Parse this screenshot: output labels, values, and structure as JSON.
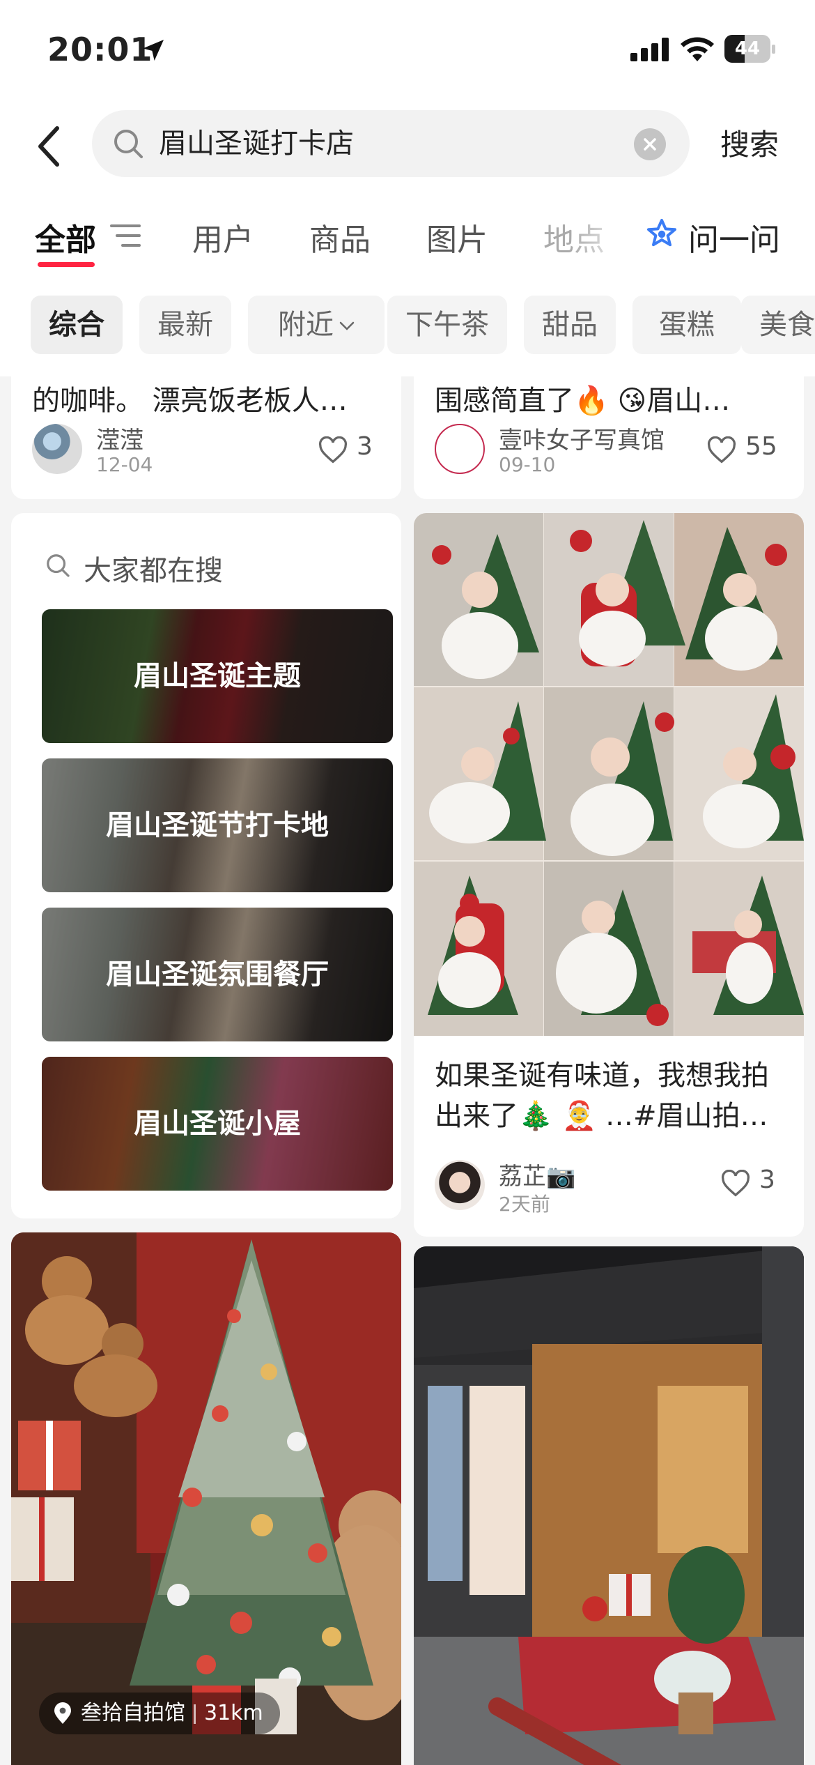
{
  "status_bar": {
    "time": "20:01",
    "battery": "44",
    "battery_level": 0.44
  },
  "search": {
    "query": "眉山圣诞打卡店",
    "button": "搜索"
  },
  "tabs": {
    "items": [
      "全部",
      "用户",
      "商品",
      "图片",
      "地点"
    ],
    "ask_label": "问一问"
  },
  "chips": [
    "综合",
    "最新",
    "附近",
    "下午茶",
    "甜品",
    "蛋糕",
    "美食"
  ],
  "feed": {
    "left_top": {
      "title": "的咖啡。 漂亮饭老板人…",
      "author": "滢滢",
      "date": "12-04",
      "likes": "3"
    },
    "right_top": {
      "title": "围感简直了🔥 😘眉山…",
      "author": "壹咔女子写真馆",
      "date": "09-10",
      "likes": "55"
    },
    "hot_search": {
      "header": "大家都在搜",
      "items": [
        "眉山圣诞主题",
        "眉山圣诞节打卡地",
        "眉山圣诞氛围餐厅",
        "眉山圣诞小屋"
      ]
    },
    "right_mid": {
      "title_line1": "如果圣诞有味道，我想我拍",
      "title_line2": "出来了🎄 🤶 …#眉山拍…",
      "author": "荔芷📷",
      "date": "2天前",
      "likes": "3"
    },
    "left_bottom": {
      "location": "叁拾自拍馆",
      "distance": "31km"
    }
  },
  "colors": {
    "accent": "#ff2442",
    "ask_icon": "#3a7cf5"
  }
}
